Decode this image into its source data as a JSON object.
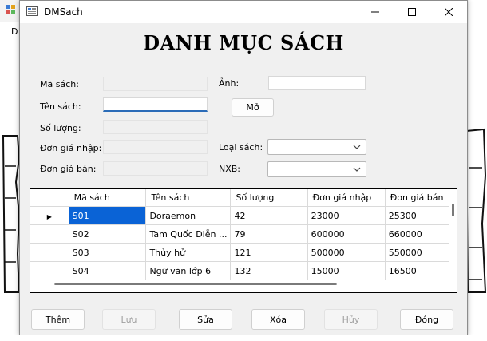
{
  "background": {
    "menu_letter": "D"
  },
  "window": {
    "title": "DMSach",
    "heading": "DANH MỤC SÁCH"
  },
  "form": {
    "ma_sach_label": "Mã sách:",
    "ten_sach_label": "Tên sách:",
    "so_luong_label": "Số lượng:",
    "don_gia_nhap_label": "Đơn giá nhập:",
    "don_gia_ban_label": "Đơn giá bán:",
    "anh_label": "Ảnh:",
    "loai_sach_label": "Loại sách:",
    "nxb_label": "NXB:",
    "mo_button": "Mở",
    "ma_sach_value": "",
    "ten_sach_value": "",
    "so_luong_value": "",
    "don_gia_nhap_value": "",
    "don_gia_ban_value": "",
    "anh_value": "",
    "loai_sach_value": "",
    "nxb_value": ""
  },
  "grid": {
    "columns": [
      "Mã sách",
      "Tên sách",
      "Số lượng",
      "Đơn giá nhập",
      "Đơn giá bán"
    ],
    "rows": [
      [
        "S01",
        "Doraemon",
        "42",
        "23000",
        "25300"
      ],
      [
        "S02",
        "Tam Quốc Diễn ...",
        "79",
        "600000",
        "660000"
      ],
      [
        "S03",
        "Thủy hử",
        "121",
        "500000",
        "550000"
      ],
      [
        "S04",
        "Ngữ văn lớp 6",
        "132",
        "15000",
        "16500"
      ]
    ],
    "current_row_marker": "▶"
  },
  "buttons": {
    "them": "Thêm",
    "luu": "Lưu",
    "sua": "Sửa",
    "xoa": "Xóa",
    "huy": "Hủy",
    "dong": "Đóng"
  },
  "colors": {
    "selection": "#0a63d6",
    "focus_underline": "#2b6cb8",
    "window_bg": "#f0f0f0"
  }
}
